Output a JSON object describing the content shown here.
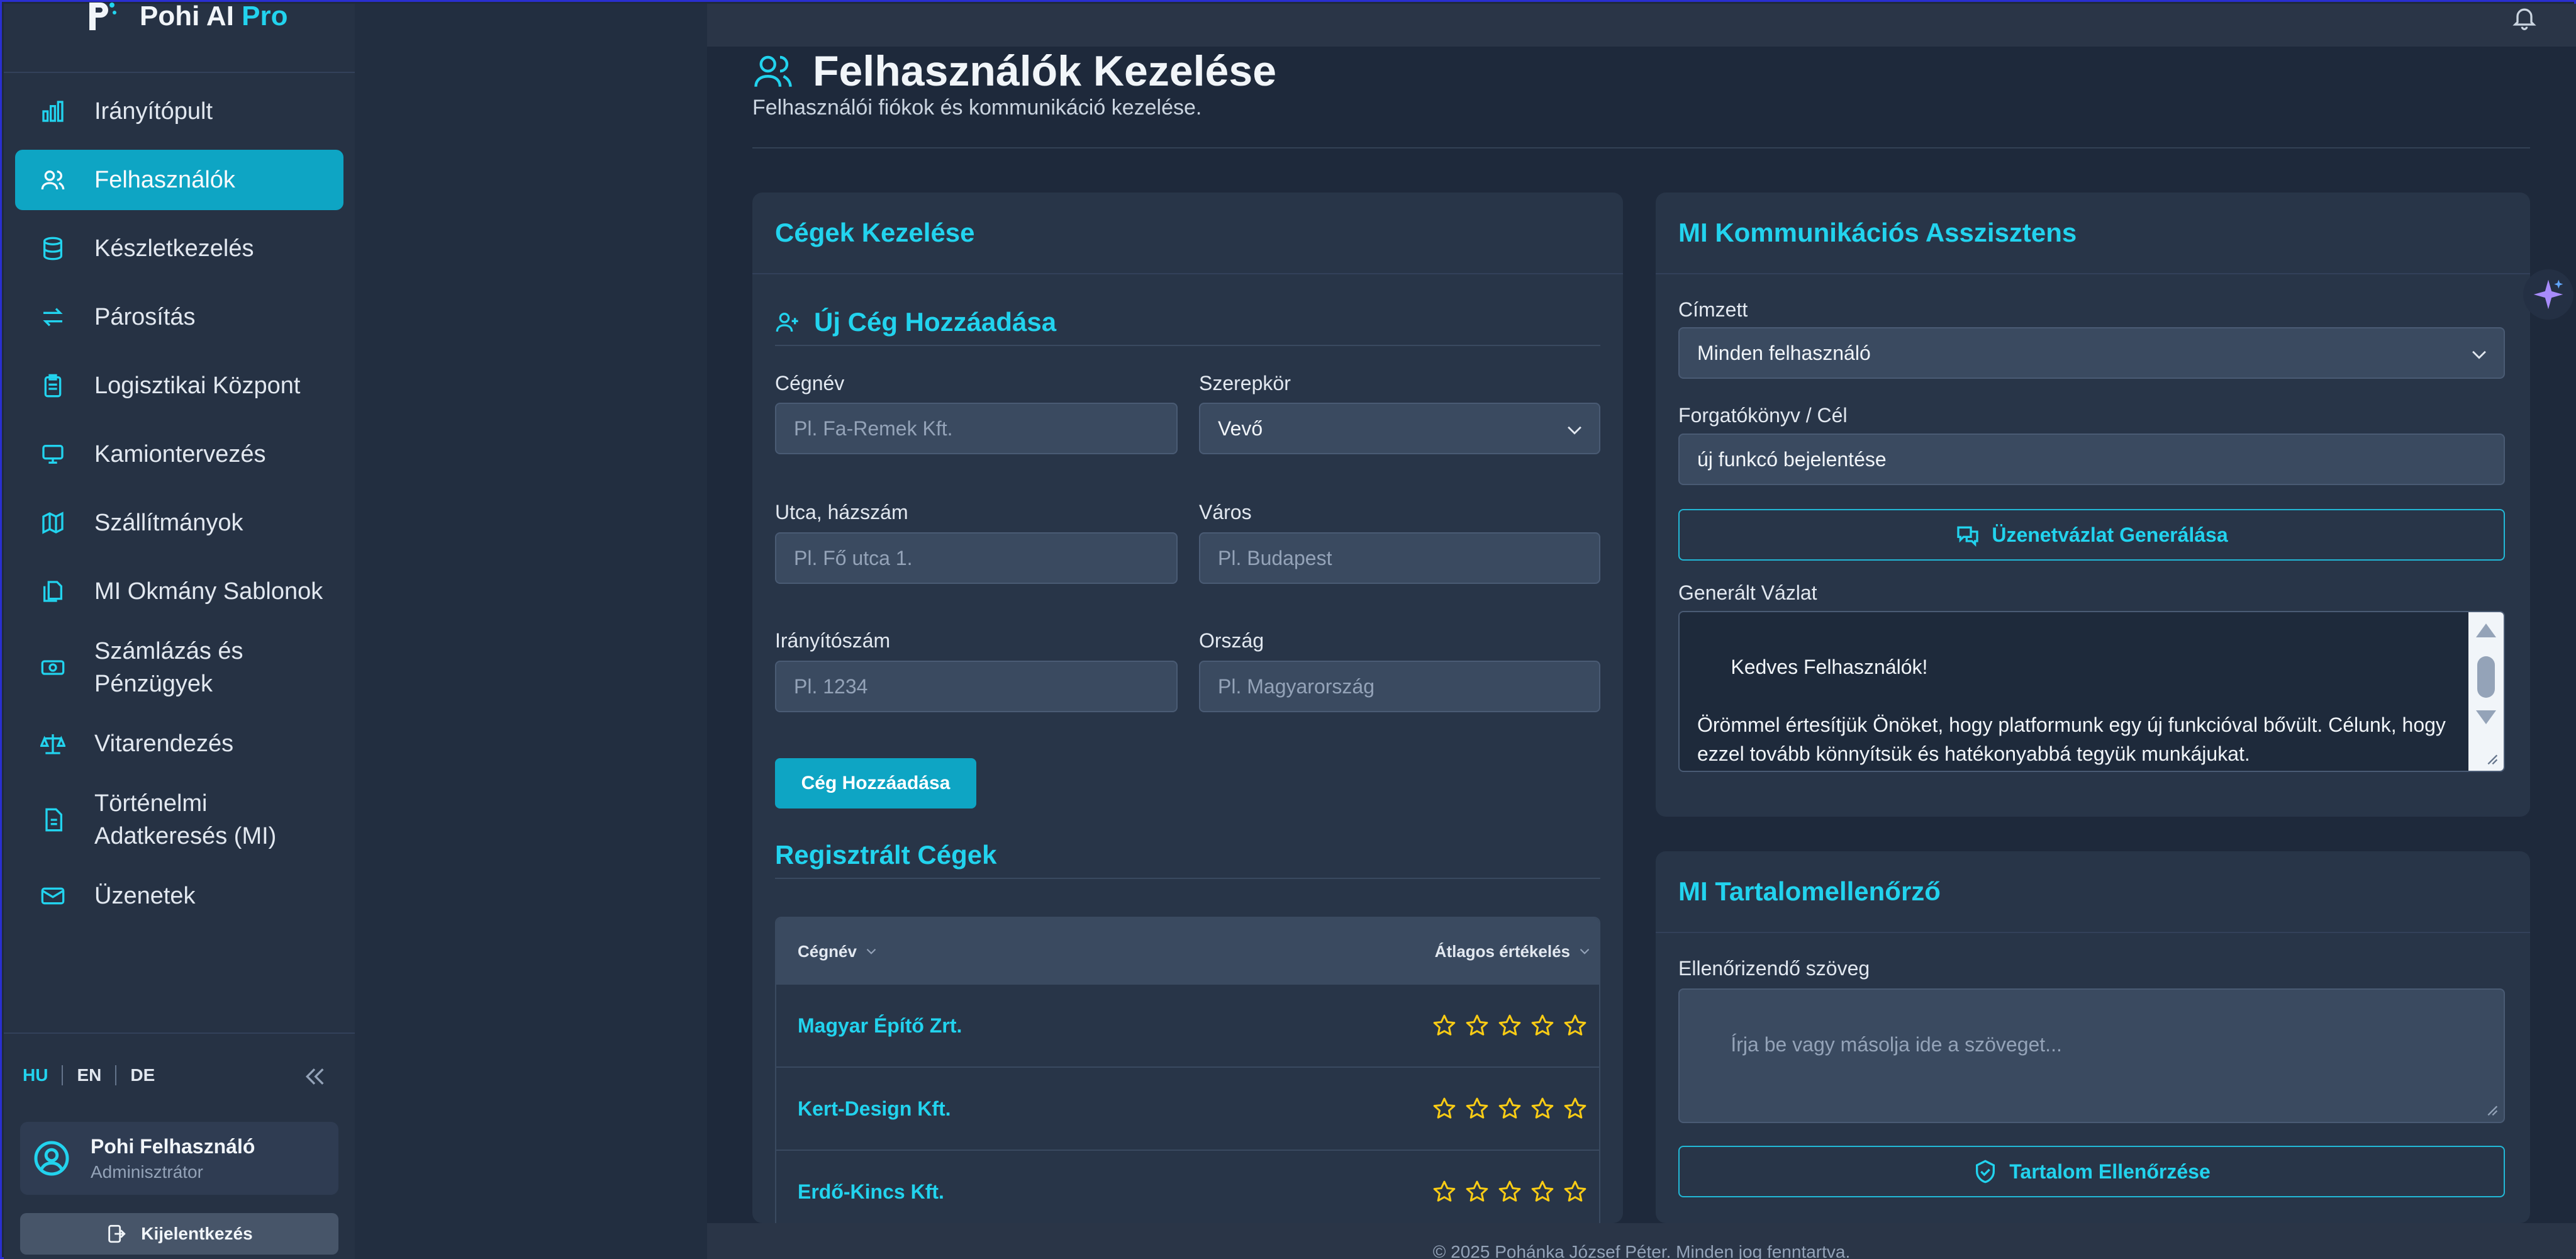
{
  "brand": {
    "name": "Pohi AI",
    "suffix": "Pro"
  },
  "nav": [
    {
      "label": "Irányítópult",
      "icon": "bar-chart-icon"
    },
    {
      "label": "Felhasználók",
      "icon": "users-icon",
      "active": true
    },
    {
      "label": "Készletkezelés",
      "icon": "database-icon"
    },
    {
      "label": "Párosítás",
      "icon": "swap-icon"
    },
    {
      "label": "Logisztikai Központ",
      "icon": "clipboard-icon"
    },
    {
      "label": "Kamiontervezés",
      "icon": "monitor-icon"
    },
    {
      "label": "Szállítmányok",
      "icon": "map-icon"
    },
    {
      "label": "MI Okmány Sablonok",
      "icon": "documents-icon"
    },
    {
      "label": "Számlázás és Pénzügyek",
      "icon": "banknote-icon"
    },
    {
      "label": "Vitarendezés",
      "icon": "scale-icon"
    },
    {
      "label": "Történelmi Adatkeresés (MI)",
      "icon": "file-search-icon"
    },
    {
      "label": "Üzenetek",
      "icon": "mail-icon"
    }
  ],
  "languages": [
    "HU",
    "EN",
    "DE"
  ],
  "user": {
    "name": "Pohi Felhasználó",
    "role": "Adminisztrátor"
  },
  "logout_label": "Kijelentkezés",
  "page": {
    "title": "Felhasználók Kezelése",
    "subtitle": "Felhasználói fiókok és kommunikáció kezelése."
  },
  "companies": {
    "title": "Cégek Kezelése",
    "add_title": "Új Cég Hozzáadása",
    "fields": {
      "name_label": "Cégnév",
      "name_placeholder": "Pl. Fa-Remek Kft.",
      "role_label": "Szerepkör",
      "role_value": "Vevő",
      "street_label": "Utca, házszám",
      "street_placeholder": "Pl. Fő utca 1.",
      "city_label": "Város",
      "city_placeholder": "Pl. Budapest",
      "zip_label": "Irányítószám",
      "zip_placeholder": "Pl. 1234",
      "country_label": "Ország",
      "country_placeholder": "Pl. Magyarország"
    },
    "add_button": "Cég Hozzáadása",
    "registered_title": "Regisztrált Cégek",
    "columns": [
      "Cégnév",
      "Átlagos értékelés"
    ],
    "rows": [
      {
        "name": "Magyar Építő Zrt.",
        "rating": 0
      },
      {
        "name": "Kert-Design Kft.",
        "rating": 0
      },
      {
        "name": "Erdő-Kincs Kft.",
        "rating": 0
      }
    ]
  },
  "assistant": {
    "title": "MI Kommunikációs Asszisztens",
    "recipient_label": "Címzett",
    "recipient_value": "Minden felhasználó",
    "script_label": "Forgatókönyv / Cél",
    "script_value": "új funkcó bejelentése",
    "generate_button": "Üzenetvázlat Generálása",
    "draft_label": "Generált Vázlat",
    "draft_text": "Kedves Felhasználók!\n\nÖrömmel értesítjük Önöket, hogy platformunk egy új funkcióval bővült. Célunk, hogy ezzel tovább könnyítsük és hatékonyabbá tegyük munkájukat.\n\nKérjük, fedezzék fel az új lehetőségeket!"
  },
  "checker": {
    "title": "MI Tartalomellenőrző",
    "text_label": "Ellenőrizendő szöveg",
    "text_placeholder": "Írja be vagy másolja ide a szöveget...",
    "check_button": "Tartalom Ellenőrzése"
  },
  "footer": "© 2025 Pohánka József Péter. Minden jog fenntartva.",
  "colors": {
    "accent": "#22d3ee",
    "active_nav": "#0ea5c4",
    "star": "#facc15"
  }
}
